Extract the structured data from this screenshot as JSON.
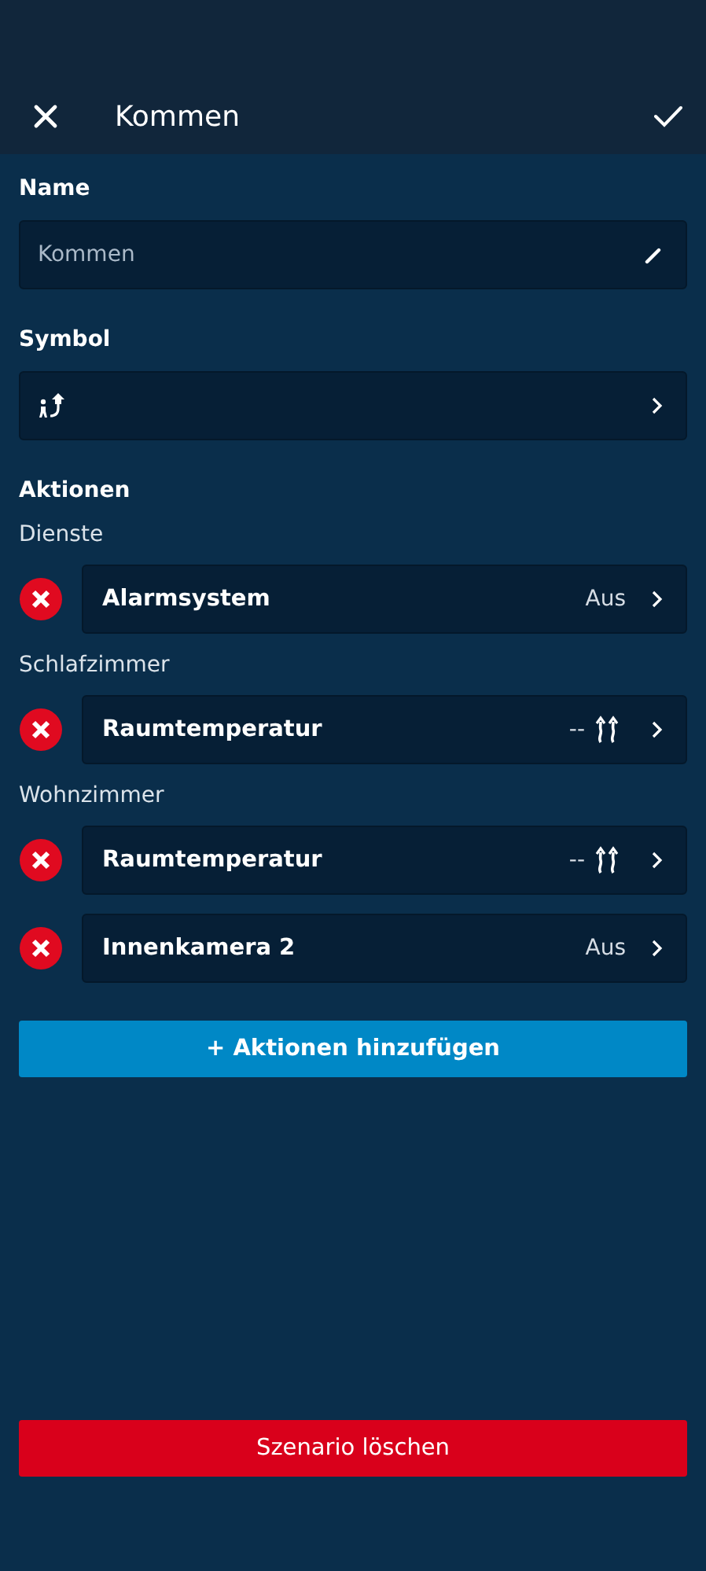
{
  "header": {
    "title": "Kommen"
  },
  "name_section": {
    "label": "Name",
    "value": "Kommen"
  },
  "symbol_section": {
    "label": "Symbol"
  },
  "actions": {
    "label": "Aktionen",
    "groups": [
      {
        "name": "Dienste",
        "items": [
          {
            "label": "Alarmsystem",
            "kind": "status",
            "value": "Aus"
          }
        ]
      },
      {
        "name": "Schlafzimmer",
        "items": [
          {
            "label": "Raumtemperatur",
            "kind": "heating",
            "value": "--"
          }
        ]
      },
      {
        "name": "Wohnzimmer",
        "items": [
          {
            "label": "Raumtemperatur",
            "kind": "heating",
            "value": "--"
          },
          {
            "label": "Innenkamera 2",
            "kind": "status",
            "value": "Aus"
          }
        ]
      }
    ]
  },
  "add_button": "+ Aktionen hinzufügen",
  "delete_button": "Szenario löschen"
}
